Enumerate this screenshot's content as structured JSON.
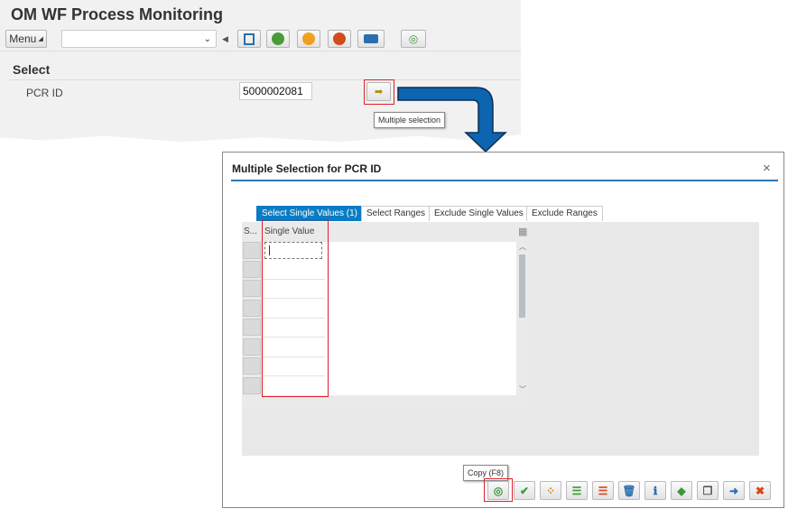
{
  "app": {
    "title": "OM WF Process Monitoring"
  },
  "toolbar": {
    "menu_label": "Menu",
    "command_field": "",
    "buttons": [
      "save-icon",
      "back-icon",
      "exit-icon",
      "cancel-icon",
      "print-icon",
      "execute-icon"
    ]
  },
  "selection": {
    "heading": "Select",
    "field_label": "PCR ID",
    "field_value": "5000002081",
    "multi_tooltip": "Multiple selection"
  },
  "dialog": {
    "title": "Multiple Selection for PCR ID",
    "close": "×",
    "tabs": [
      {
        "label": "Select Single Values (1)",
        "active": true
      },
      {
        "label": "Select Ranges"
      },
      {
        "label": "Exclude Single Values"
      },
      {
        "label": "Exclude Ranges"
      }
    ],
    "table": {
      "col_sel": "S...",
      "col_value": "Single Value",
      "rows": [
        "",
        "",
        "",
        "",
        "",
        "",
        "",
        ""
      ]
    },
    "copy_tooltip": "Copy (F8)",
    "buttons": [
      "copy",
      "check",
      "multiple-selection",
      "insert-line",
      "delete-line",
      "delete-all",
      "help",
      "import-text",
      "upload",
      "paste",
      "cancel"
    ]
  },
  "colors": {
    "accent": "#0a7cc3",
    "highlight": "#e0202a",
    "arrow": "#0d64b0"
  }
}
